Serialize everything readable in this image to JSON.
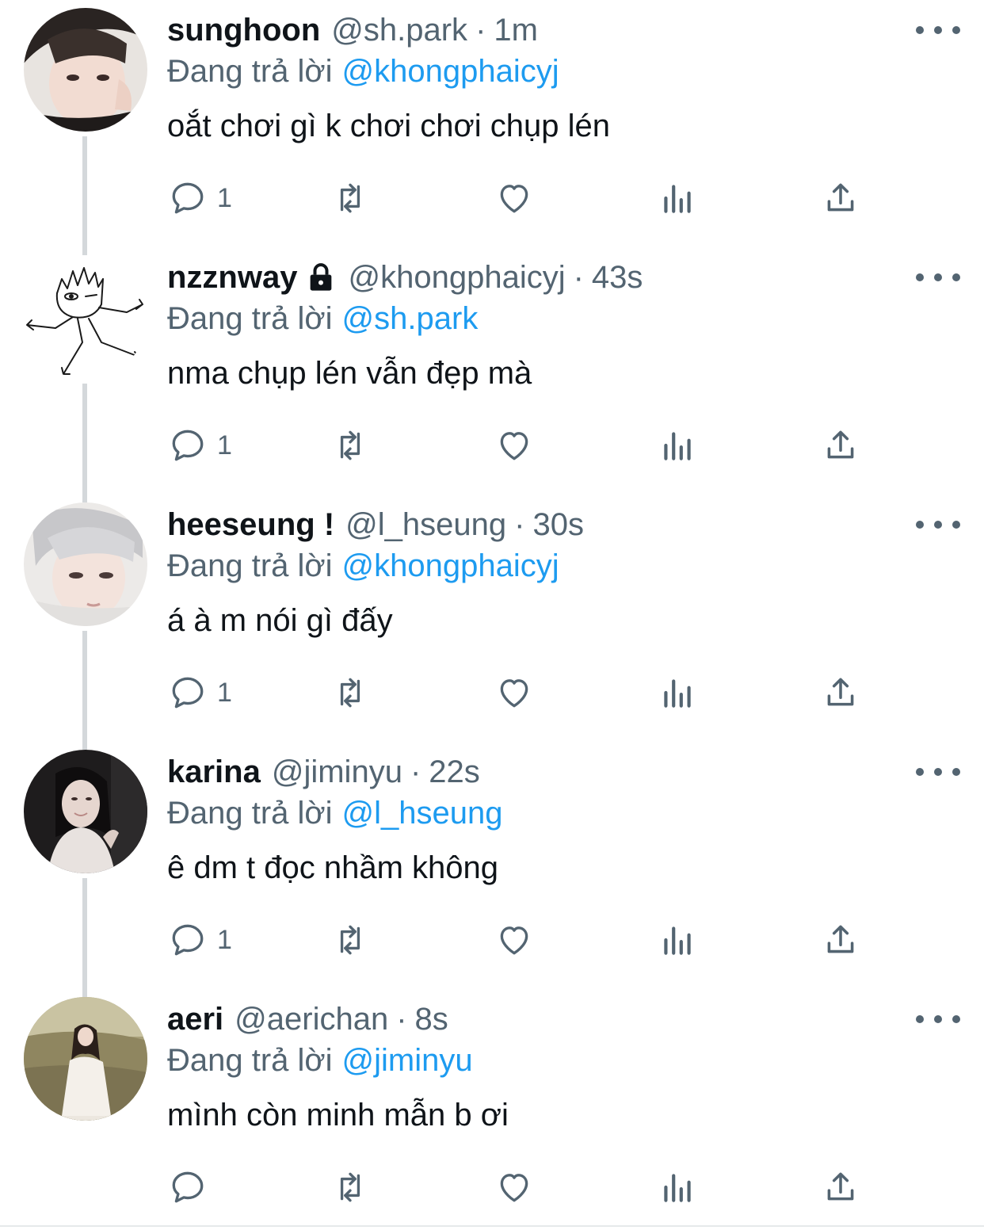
{
  "colors": {
    "link": "#1d9bf0",
    "secondary": "#536471",
    "primary_text": "#0f1419",
    "thread_line": "#d4d8db"
  },
  "tweets": [
    {
      "name": "sunghoon",
      "handle": "@sh.park",
      "separator": "·",
      "time": "1m",
      "locked": false,
      "reply_prefix": "Đang trả lời",
      "reply_to": "@khongphaicyj",
      "text": "oắt chơi gì k chơi chơi chụp lén",
      "reply_count": "1",
      "avatar_icon": "profile-photo"
    },
    {
      "name": "nzznway",
      "handle": "@khongphaicyj",
      "separator": "·",
      "time": "43s",
      "locked": true,
      "reply_prefix": "Đang trả lời",
      "reply_to": "@sh.park",
      "text": "nma chụp lén vẫn đẹp mà",
      "reply_count": "1",
      "avatar_icon": "doodle-figure"
    },
    {
      "name": "heeseung !",
      "handle": "@l_hseung",
      "separator": "·",
      "time": "30s",
      "locked": false,
      "reply_prefix": "Đang trả lời",
      "reply_to": "@khongphaicyj",
      "text": "á à m nói gì đấy",
      "reply_count": "1",
      "avatar_icon": "profile-photo"
    },
    {
      "name": "karina",
      "handle": "@jiminyu",
      "separator": "·",
      "time": "22s",
      "locked": false,
      "reply_prefix": "Đang trả lời",
      "reply_to": "@l_hseung",
      "text": "ê dm t đọc nhầm không",
      "reply_count": "1",
      "avatar_icon": "profile-photo"
    },
    {
      "name": "aeri",
      "handle": "@aerichan",
      "separator": "·",
      "time": "8s",
      "locked": false,
      "reply_prefix": "Đang trả lời",
      "reply_to": "@jiminyu",
      "text": "mình còn minh mẫn b ơi",
      "reply_count": "",
      "avatar_icon": "profile-photo"
    }
  ]
}
